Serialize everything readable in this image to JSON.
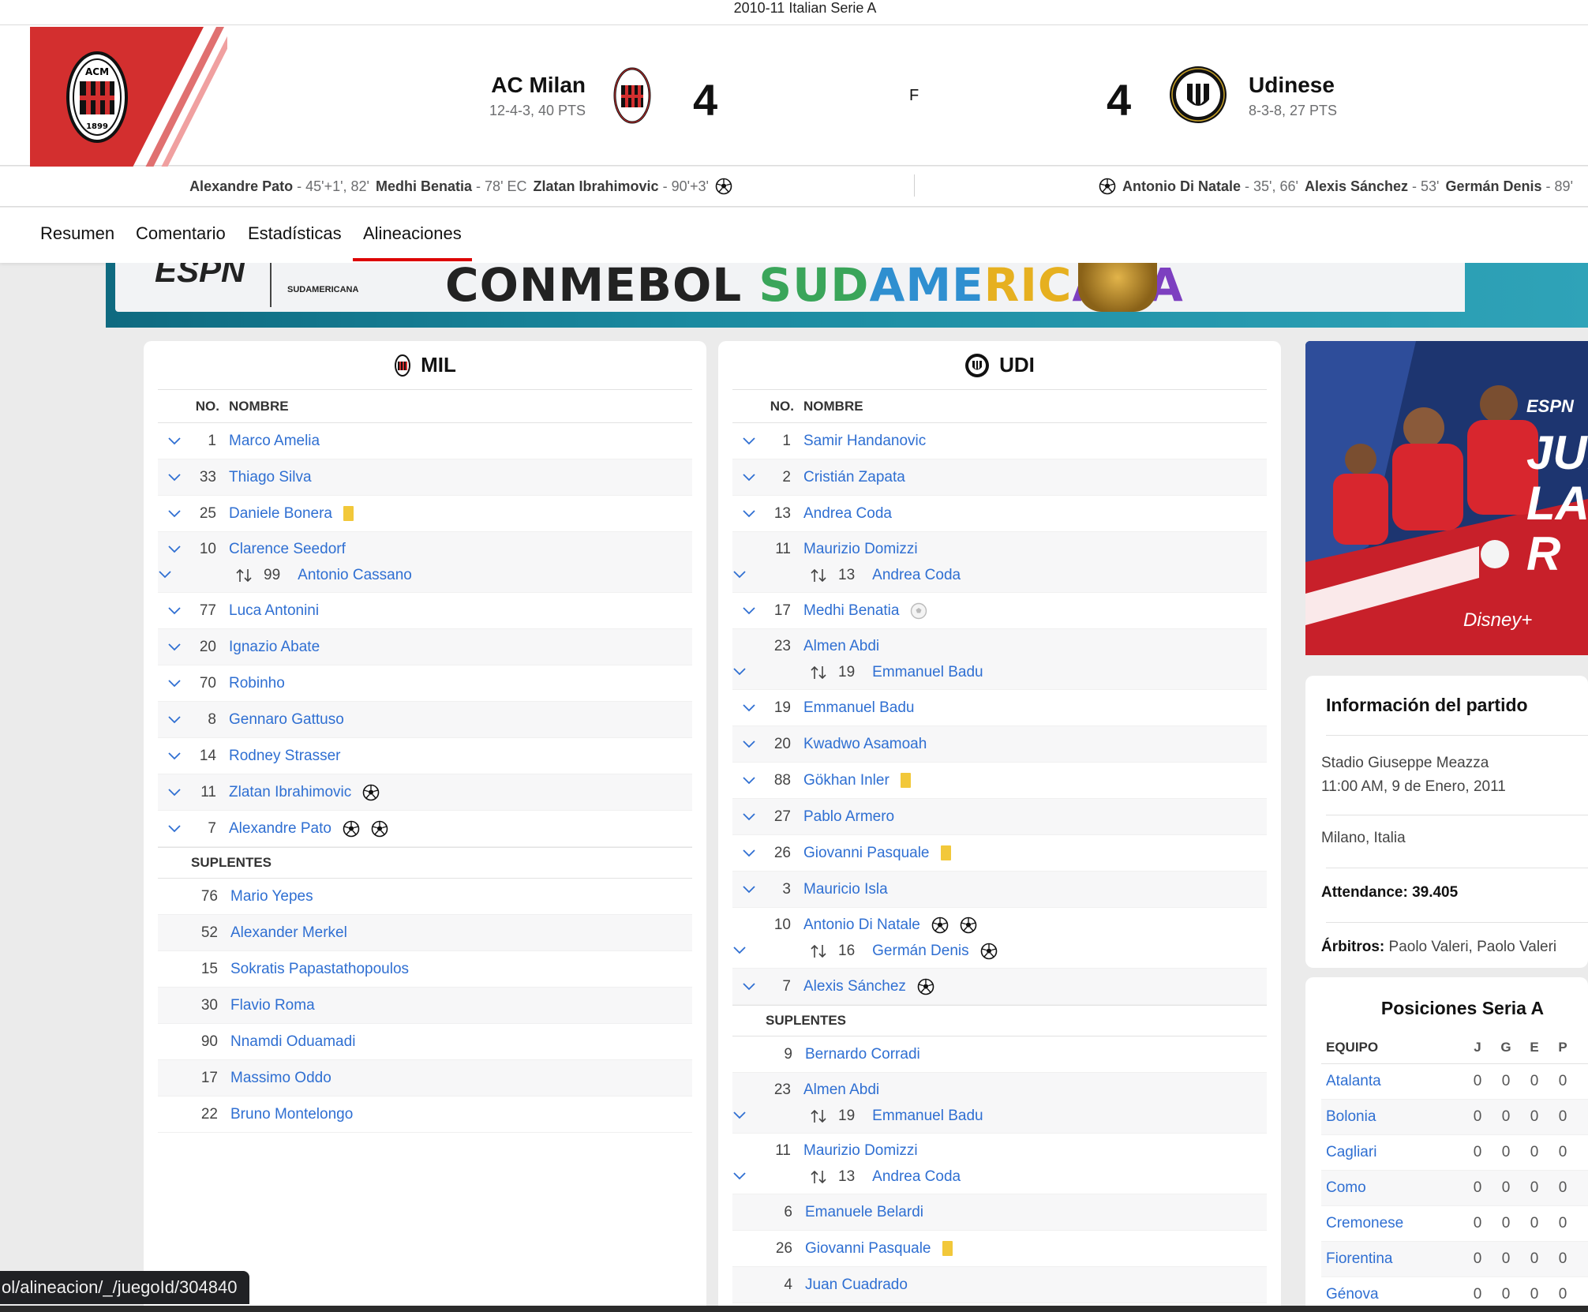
{
  "league": "2010-11 Italian Serie A",
  "home": {
    "name": "AC Milan",
    "record": "12-4-3, 40 PTS",
    "score": "4",
    "abbr": "MIL"
  },
  "away": {
    "name": "Udinese",
    "record": "8-3-8, 27 PTS",
    "score": "4",
    "abbr": "UDI"
  },
  "status": "F",
  "scorers_home": [
    {
      "player": "Alexandre Pato",
      "minutes": "- 45'+1', 82'"
    },
    {
      "player": "Medhi Benatia",
      "minutes": "- 78' EC"
    },
    {
      "player": "Zlatan Ibrahimovic",
      "minutes": "- 90'+3'"
    }
  ],
  "scorers_away": [
    {
      "player": "Antonio Di Natale",
      "minutes": "- 35', 66'"
    },
    {
      "player": "Alexis Sánchez",
      "minutes": "- 53'"
    },
    {
      "player": "Germán Denis",
      "minutes": "- 89'"
    }
  ],
  "tabs": [
    "Resumen",
    "Comentario",
    "Estadísticas",
    "Alineaciones"
  ],
  "active_tab": "Alineaciones",
  "banner": {
    "brand": "ESPN",
    "sub": "SUDAMERICANA",
    "title": "CONMEBOL SUDAMERICANA"
  },
  "lineup_cols": {
    "no": "NO.",
    "name": "NOMBRE"
  },
  "subs_label": "SUPLENTES",
  "mil": {
    "starters": [
      {
        "no": "1",
        "name": "Marco Amelia"
      },
      {
        "no": "33",
        "name": "Thiago Silva"
      },
      {
        "no": "25",
        "name": "Daniele Bonera",
        "yellow": true
      },
      {
        "no": "10",
        "name": "Clarence Seedorf",
        "sub_no": "99",
        "sub_name": "Antonio Cassano"
      },
      {
        "no": "77",
        "name": "Luca Antonini"
      },
      {
        "no": "20",
        "name": "Ignazio Abate"
      },
      {
        "no": "70",
        "name": "Robinho"
      },
      {
        "no": "8",
        "name": "Gennaro Gattuso"
      },
      {
        "no": "14",
        "name": "Rodney Strasser"
      },
      {
        "no": "11",
        "name": "Zlatan Ibrahimovic",
        "goals": 1
      },
      {
        "no": "7",
        "name": "Alexandre Pato",
        "goals": 2
      }
    ],
    "subs": [
      {
        "no": "76",
        "name": "Mario Yepes"
      },
      {
        "no": "52",
        "name": "Alexander Merkel"
      },
      {
        "no": "15",
        "name": "Sokratis Papastathopoulos"
      },
      {
        "no": "30",
        "name": "Flavio Roma"
      },
      {
        "no": "90",
        "name": "Nnamdi Oduamadi"
      },
      {
        "no": "17",
        "name": "Massimo Oddo"
      },
      {
        "no": "22",
        "name": "Bruno Montelongo"
      }
    ]
  },
  "udi": {
    "starters": [
      {
        "no": "1",
        "name": "Samir Handanovic"
      },
      {
        "no": "2",
        "name": "Cristián Zapata"
      },
      {
        "no": "13",
        "name": "Andrea Coda"
      },
      {
        "no": "11",
        "name": "Maurizio Domizzi",
        "sub_no": "13",
        "sub_name": "Andrea Coda"
      },
      {
        "no": "17",
        "name": "Medhi Benatia",
        "owngoal": true
      },
      {
        "no": "23",
        "name": "Almen Abdi",
        "sub_no": "19",
        "sub_name": "Emmanuel Badu"
      },
      {
        "no": "19",
        "name": "Emmanuel Badu"
      },
      {
        "no": "20",
        "name": "Kwadwo Asamoah"
      },
      {
        "no": "88",
        "name": "Gökhan Inler",
        "yellow": true
      },
      {
        "no": "27",
        "name": "Pablo Armero"
      },
      {
        "no": "26",
        "name": "Giovanni Pasquale",
        "yellow": true
      },
      {
        "no": "3",
        "name": "Mauricio Isla"
      },
      {
        "no": "10",
        "name": "Antonio Di Natale",
        "goals": 2,
        "sub_no": "16",
        "sub_name": "Germán Denis",
        "sub_goals": 1
      },
      {
        "no": "7",
        "name": "Alexis Sánchez",
        "goals": 1
      }
    ],
    "subs": [
      {
        "no": "9",
        "name": "Bernardo Corradi"
      },
      {
        "no": "23",
        "name": "Almen Abdi",
        "sub_no": "19",
        "sub_name": "Emmanuel Badu"
      },
      {
        "no": "11",
        "name": "Maurizio Domizzi",
        "sub_no": "13",
        "sub_name": "Andrea Coda"
      },
      {
        "no": "6",
        "name": "Emanuele Belardi"
      },
      {
        "no": "26",
        "name": "Giovanni Pasquale",
        "yellow": true
      },
      {
        "no": "4",
        "name": "Juan Cuadrado"
      }
    ]
  },
  "info": {
    "title": "Información del partido",
    "stadium": "Stadio Giuseppe Meazza",
    "datetime": "11:00 AM, 9 de Enero, 2011",
    "city": "Milano, Italia",
    "attendance": "Attendance: 39.405",
    "referees_label": "Árbitros:",
    "referees": "Paolo Valeri, Paolo Valeri"
  },
  "promo": {
    "brand": "ESPN",
    "headline": "JUE LA R",
    "partner": "Disney+"
  },
  "standings": {
    "title": "Posiciones Seria A",
    "cols": [
      "EQUIPO",
      "J",
      "G",
      "E",
      "P"
    ],
    "rows": [
      {
        "team": "Atalanta",
        "j": "0",
        "g": "0",
        "e": "0",
        "p": "0"
      },
      {
        "team": "Bolonia",
        "j": "0",
        "g": "0",
        "e": "0",
        "p": "0"
      },
      {
        "team": "Cagliari",
        "j": "0",
        "g": "0",
        "e": "0",
        "p": "0"
      },
      {
        "team": "Como",
        "j": "0",
        "g": "0",
        "e": "0",
        "p": "0"
      },
      {
        "team": "Cremonese",
        "j": "0",
        "g": "0",
        "e": "0",
        "p": "0"
      },
      {
        "team": "Fiorentina",
        "j": "0",
        "g": "0",
        "e": "0",
        "p": "0"
      },
      {
        "team": "Génova",
        "j": "0",
        "g": "0",
        "e": "0",
        "p": "0"
      }
    ]
  },
  "url_tooltip": "ol/alineacion/_/juegoId/304840",
  "colors": {
    "milan_red": "#d32f2f",
    "link": "#2f6fd2",
    "yellow_card": "#f2c83a",
    "tab_active": "#dd0000"
  }
}
